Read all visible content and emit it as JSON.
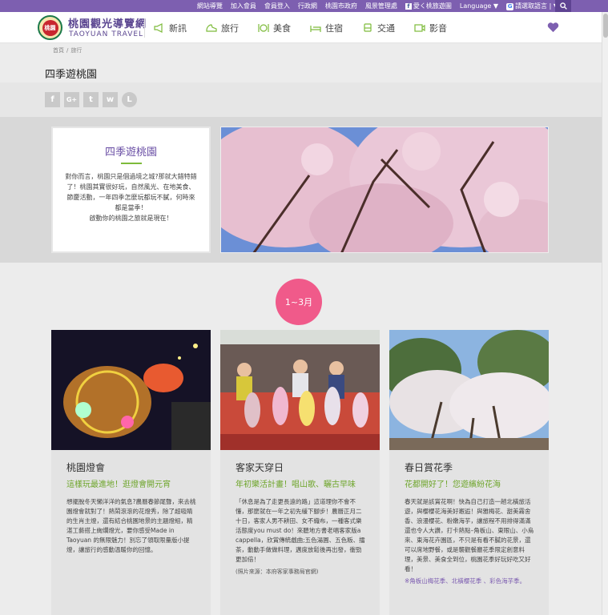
{
  "topbar": {
    "links": [
      "網站導覽",
      "加入會員",
      "會員登入",
      "行政網",
      "桃園市政府",
      "風景管理處"
    ],
    "fb_label": "愛く桃旅遊圖",
    "language_label": "Language ▼",
    "translate_label": "請選取語言 | ▼"
  },
  "header": {
    "logo_mark": "桃園",
    "site_title": "桃園觀光導覽網",
    "site_subtitle": "TAOYUAN TRAVEL",
    "nav": [
      {
        "label": "新訊",
        "icon": "megaphone-icon"
      },
      {
        "label": "旅行",
        "icon": "shoe-icon"
      },
      {
        "label": "美食",
        "icon": "dining-icon"
      },
      {
        "label": "住宿",
        "icon": "bed-icon"
      },
      {
        "label": "交通",
        "icon": "bus-icon"
      },
      {
        "label": "影音",
        "icon": "video-icon"
      }
    ]
  },
  "breadcrumb": {
    "home": "首頁",
    "sep": "/",
    "current": "旅行"
  },
  "page": {
    "title": "四季遊桃園"
  },
  "share": [
    "facebook-icon",
    "google-plus-icon",
    "twitter-icon",
    "weibo-icon",
    "line-icon"
  ],
  "share_labels": {
    "fb": "f",
    "gplus": "G+",
    "tw": "t",
    "weibo": "w",
    "line": "L"
  },
  "intro": {
    "title": "四季遊桃園",
    "text": "對你而言，桃園只是個過境之城?那就大錯特錯了！桃園其實很好玩，自然風光、在地美食、節慶活動，一年四季怎麼玩都玩不膩，何時來都是當季！",
    "text2": "啟動你的桃園之旅就是現在！"
  },
  "season": {
    "badge": "1~3月"
  },
  "cards": [
    {
      "title": "桃園燈會",
      "subtitle": "這樣玩最進地！逛燈會開元宵",
      "body": "想擺脫冬天懶洋洋的氣息?農曆春節尾聲，來去桃園燈會就對了！熱鬧滾滾的花燈秀，除了超吸睛的生肖主燈，還有結合桃園地景的主題燈組，精湛工藝搭上絢爛燈光，要你感受Made in Taoyuan 的無限魅力！別忘了領取限量版小提燈，讓旅行的感動溫暖你的回憶。"
    },
    {
      "title": "客家天穿日",
      "subtitle": "年初樂活計畫！唱山歌、曬古早味",
      "body": "「休息是為了走更長遠的路」這道理你不會不懂，那麼就在一年之初先緩下腳步！農曆正月二十日，客家人男不耕田、女不織布，一種客式樂活態度you must do！來聽地方書老唱客家版a cappella，欣賞傳統戲曲;五色湯圓、五色粄、擂茶，動動手做做料理，邁度放鬆後再出發，衝勁更加倍！",
      "note": "(照片來源：本府客家事務局官網)"
    },
    {
      "title": "春日賞花季",
      "subtitle": "花都開好了！您遊繽紛花海",
      "body": "春天就是該賞花啊！快為自己打造一趟北橫旅活遊，與櫻櫻花海美好邂逅！與雅梅花、甜美霧舍香、浪漫櫻花、粉嫩海芋，讓旅程不用排得滿滿還也令人大讚，打卡熱點–角板山、東眼山、小烏來、東海花卉園區，不只是有看不膩的花景，還可以席地野餐，或是襲觀餐廳花季限定創意料理，美景、美食全到位，桃園花季好玩好吃又好看！",
      "link": "※角板山梅花季、北橫櫻花季 、彩色海芋季。"
    }
  ]
}
